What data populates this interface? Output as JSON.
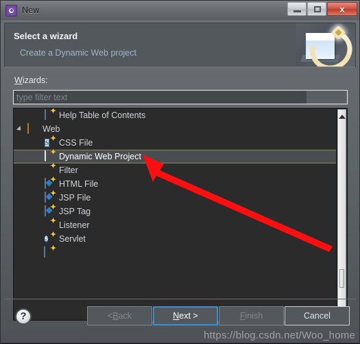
{
  "window": {
    "title": "New",
    "icon": "gear-icon",
    "controls": {
      "minimize": "minimize-icon",
      "maximize": "maximize-icon",
      "close": "x"
    }
  },
  "header": {
    "title": "Select a wizard",
    "subtitle": "Create a Dynamic Web project",
    "art": "wizard-banner-icon"
  },
  "form": {
    "wizards_label_prefix": "W",
    "wizards_label_rest": "izards:",
    "filter_placeholder": "type filter text",
    "filter_value": ""
  },
  "tree": {
    "items": [
      {
        "label": "Help Table of Contents",
        "icon": "help-toc-icon",
        "level": "child",
        "selected": false
      },
      {
        "label": "Web",
        "icon": "folder-open-icon",
        "level": "group",
        "selected": false,
        "expanded": true
      },
      {
        "label": "CSS File",
        "icon": "css-file-icon",
        "level": "child",
        "selected": false
      },
      {
        "label": "Dynamic Web Project",
        "icon": "dynamic-web-project-icon",
        "level": "child",
        "selected": true
      },
      {
        "label": "Filter",
        "icon": "filter-icon",
        "level": "child",
        "selected": false
      },
      {
        "label": "HTML File",
        "icon": "html-file-icon",
        "level": "child",
        "selected": false
      },
      {
        "label": "JSP File",
        "icon": "jsp-file-icon",
        "level": "child",
        "selected": false
      },
      {
        "label": "JSP Tag",
        "icon": "jsp-tag-icon",
        "level": "child",
        "selected": false
      },
      {
        "label": "Listener",
        "icon": "listener-icon",
        "level": "child",
        "selected": false
      },
      {
        "label": "Servlet",
        "icon": "servlet-icon",
        "level": "child",
        "selected": false
      },
      {
        "label": "",
        "icon": "partial-item-icon",
        "level": "child",
        "selected": false
      }
    ]
  },
  "footer": {
    "help_label": "?",
    "buttons": [
      {
        "name": "back",
        "pre": "< ",
        "mnemonic": "B",
        "post": "ack",
        "state": "disabled"
      },
      {
        "name": "next",
        "pre": "",
        "mnemonic": "N",
        "post": "ext >",
        "state": "focused"
      },
      {
        "name": "finish",
        "pre": "",
        "mnemonic": "F",
        "post": "inish",
        "state": "disabled"
      },
      {
        "name": "cancel",
        "pre": "",
        "mnemonic": "",
        "post": "Cancel",
        "state": "enabled"
      }
    ]
  },
  "annotation": {
    "watermark": "https://blog.csdn.net/Woo_home",
    "arrow_color": "#fb0f0f"
  }
}
